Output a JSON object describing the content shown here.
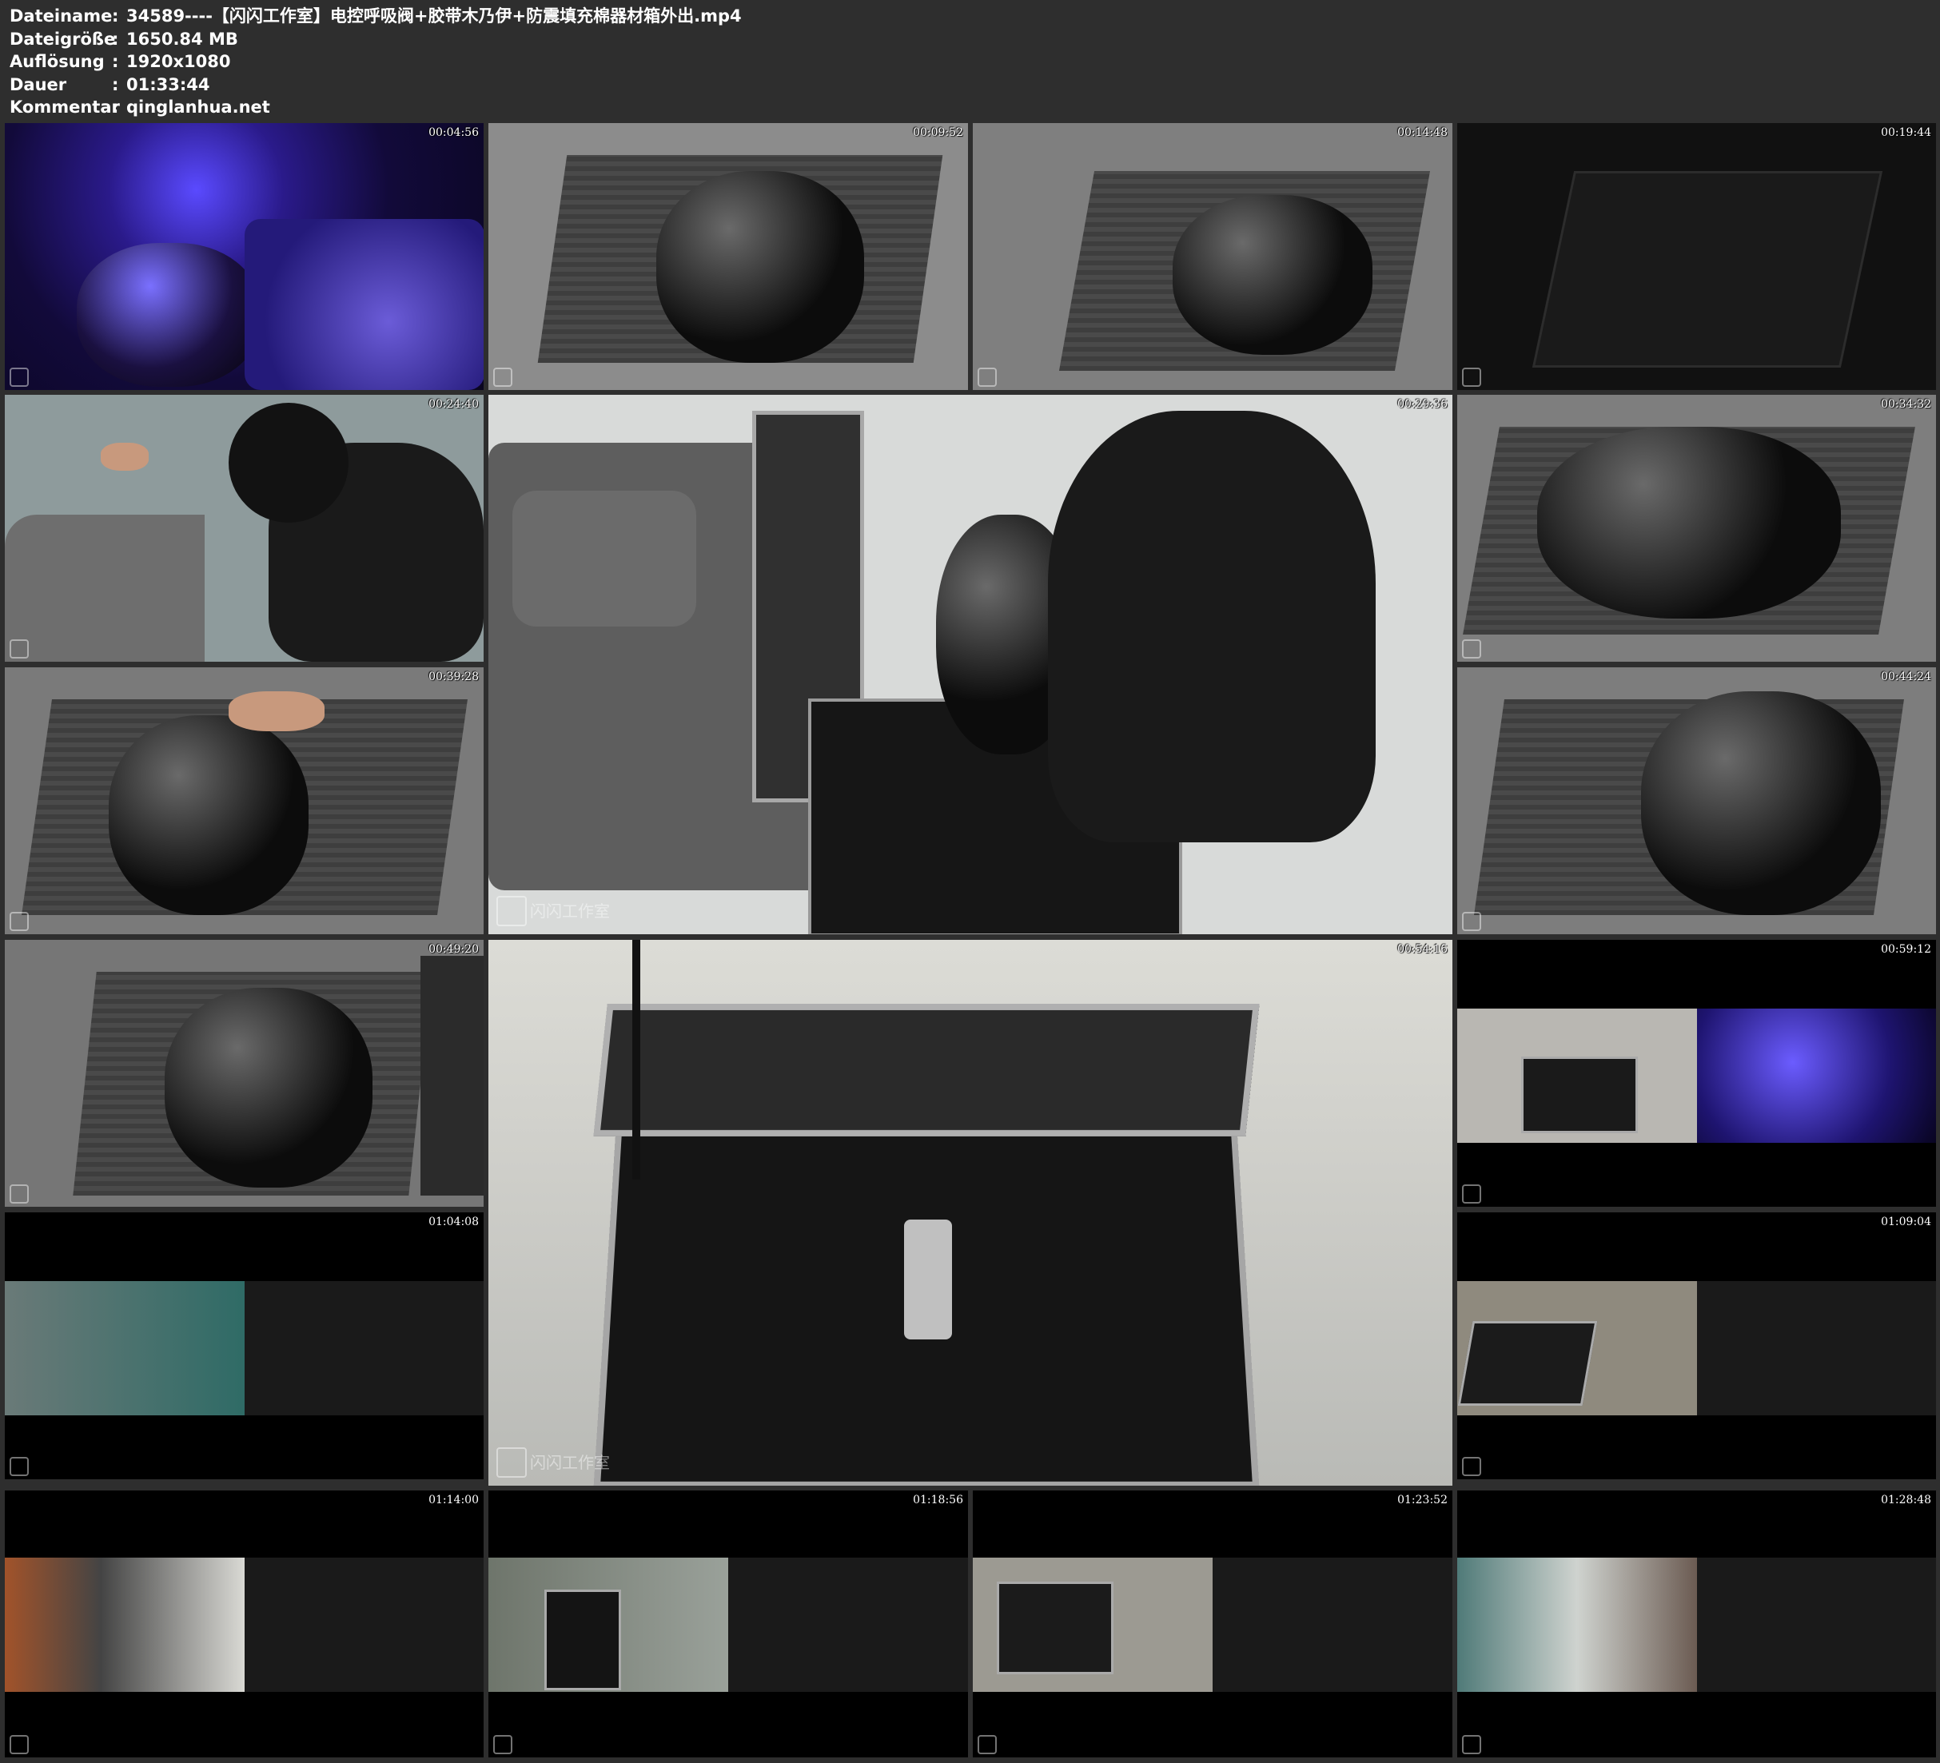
{
  "info": {
    "rows": [
      {
        "key": "Dateiname",
        "sep": ":",
        "value": "34589----【闪闪工作室】电控呼吸阀+胶带木乃伊+防震填充棉器材箱外出.mp4"
      },
      {
        "key": "Dateigröße",
        "sep": ":",
        "value": "1650.84 MB"
      },
      {
        "key": "Auflösung",
        "sep": ":",
        "value": "1920x1080"
      },
      {
        "key": "Dauer",
        "sep": ":",
        "value": "01:33:44"
      },
      {
        "key": "Kommentar",
        "sep": ":",
        "value": "qinglanhua.net"
      }
    ]
  },
  "watermark": "闪闪工作室",
  "thumbnails": [
    {
      "time": "00:04:56"
    },
    {
      "time": "00:09:52"
    },
    {
      "time": "00:14:48"
    },
    {
      "time": "00:19:44"
    },
    {
      "time": "00:24:40"
    },
    {
      "time": "00:29:36"
    },
    {
      "time": "00:34:32"
    },
    {
      "time": "00:39:28"
    },
    {
      "time": "00:44:24"
    },
    {
      "time": "00:49:20"
    },
    {
      "time": "00:54:16"
    },
    {
      "time": "00:59:12"
    },
    {
      "time": "01:04:08"
    },
    {
      "time": "01:09:04"
    },
    {
      "time": "01:14:00"
    },
    {
      "time": "01:18:56"
    },
    {
      "time": "01:23:52"
    },
    {
      "time": "01:28:48"
    }
  ]
}
